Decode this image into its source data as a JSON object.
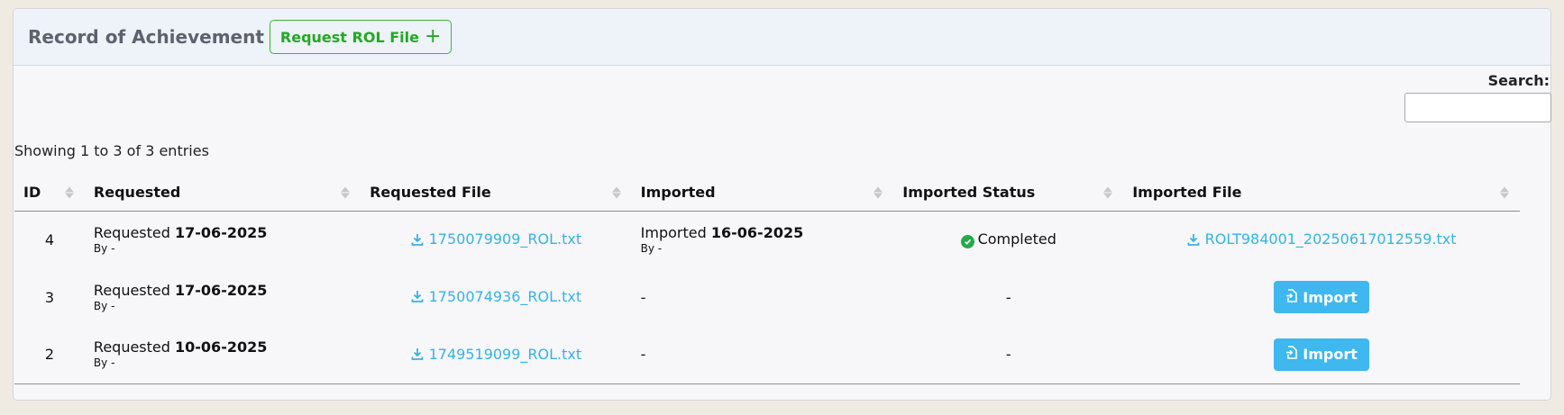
{
  "header": {
    "title": "Record of Achievement",
    "request_button": "Request ROL File"
  },
  "search": {
    "label": "Search:",
    "placeholder": ""
  },
  "info": "Showing 1 to 3 of 3 entries",
  "columns": [
    "ID",
    "Requested",
    "Requested File",
    "Imported",
    "Imported Status",
    "Imported File"
  ],
  "rows": [
    {
      "id": "4",
      "requested_prefix": "Requested",
      "requested_date": "17-06-2025",
      "requested_by": "By -",
      "requested_file": "1750079909_ROL.txt",
      "imported_prefix": "Imported",
      "imported_date": "16-06-2025",
      "imported_by": "By -",
      "status": "Completed",
      "imported_file": "ROLT984001_20250617012559.txt"
    },
    {
      "id": "3",
      "requested_prefix": "Requested",
      "requested_date": "17-06-2025",
      "requested_by": "By -",
      "requested_file": "1750074936_ROL.txt",
      "imported": "-",
      "status": "-",
      "import_button": "Import"
    },
    {
      "id": "2",
      "requested_prefix": "Requested",
      "requested_date": "10-06-2025",
      "requested_by": "By -",
      "requested_file": "1749519099_ROL.txt",
      "imported": "-",
      "status": "-",
      "import_button": "Import"
    }
  ],
  "colors": {
    "accent_green": "#25a825",
    "link_blue": "#36b3e3",
    "button_blue": "#3eb8ee",
    "status_green": "#26a84a"
  },
  "icons": {
    "add": "plus-icon",
    "download": "download-icon",
    "completed": "check-circle-icon",
    "import": "file-import-icon",
    "sort": "sort-icon"
  }
}
